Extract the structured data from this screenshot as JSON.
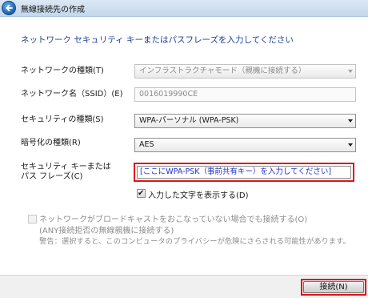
{
  "window": {
    "title": "無線接続先の作成"
  },
  "heading": "ネットワーク セキュリティ キーまたはパスフレーズを入力してください",
  "fields": {
    "network_type": {
      "label": "ネットワークの種類(T)",
      "value": "インフラストラクチャモード（親機に接続する）"
    },
    "ssid": {
      "label": "ネットワーク名（SSID）(E)",
      "value": "0016019990CE"
    },
    "security_type": {
      "label": "セキュリティの種類(S)",
      "value": "WPA-パーソナル (WPA-PSK)"
    },
    "encryption_type": {
      "label": "暗号化の種類(R)",
      "value": "AES"
    },
    "passphrase": {
      "label_line1": "セキュリティ キーまたは",
      "label_line2": "パス フレーズ(C)",
      "value": "[ここにWPA-PSK（事前共有キー）を入力してください]"
    }
  },
  "show_chars": {
    "label": "入力した文字を表示する(D)",
    "checked": true
  },
  "broadcast": {
    "line1": "ネットワークがブロードキャストをおこなっていない場合でも接続する(O)",
    "line2": "(ANY接続拒否の無線親機に接続する)",
    "warning": "警告：選択すると、このコンピュータのプライバシーが危険にさらされる可能性があります。",
    "checked": false
  },
  "buttons": {
    "connect": "接続(N)"
  },
  "colors": {
    "highlight_red": "#e0121a",
    "heading_blue": "#1c3f94",
    "passphrase_blue": "#1a2ed0"
  },
  "icons": {
    "back": "back-arrow-icon"
  }
}
